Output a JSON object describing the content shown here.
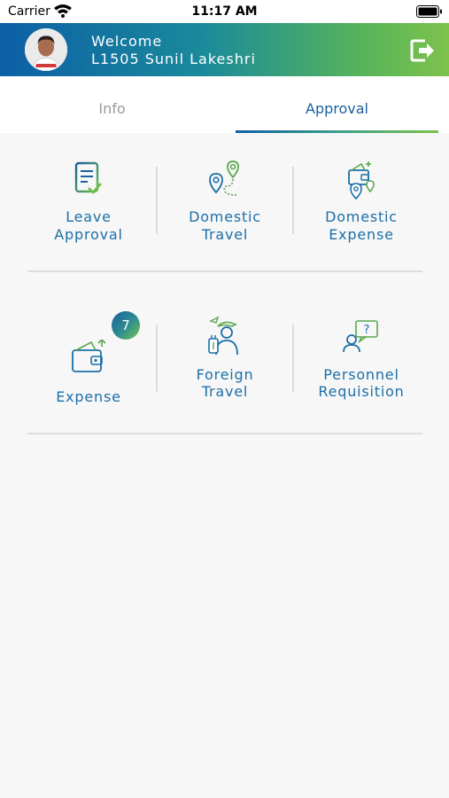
{
  "status": {
    "carrier": "Carrier",
    "time": "11:17 AM"
  },
  "header": {
    "welcome": "Welcome",
    "user": "L1505 Sunil Lakeshri"
  },
  "tabs": [
    {
      "label": "Info",
      "active": false
    },
    {
      "label": "Approval",
      "active": true
    }
  ],
  "tiles": [
    {
      "line1": "Leave",
      "line2": "Approval",
      "icon": "leave-approval-icon"
    },
    {
      "line1": "Domestic",
      "line2": "Travel",
      "icon": "domestic-travel-icon"
    },
    {
      "line1": "Domestic",
      "line2": "Expense",
      "icon": "domestic-expense-icon"
    },
    {
      "line1": "Expense",
      "icon": "expense-wallet-icon",
      "badge": "7"
    },
    {
      "line1": "Foreign",
      "line2": "Travel",
      "icon": "foreign-travel-icon"
    },
    {
      "line1": "Personnel",
      "line2": "Requisition",
      "icon": "personnel-requisition-icon"
    }
  ],
  "colors": {
    "accent_blue": "#1b6fa8",
    "accent_green": "#7dc24b",
    "header_start": "#0c5fa5"
  }
}
